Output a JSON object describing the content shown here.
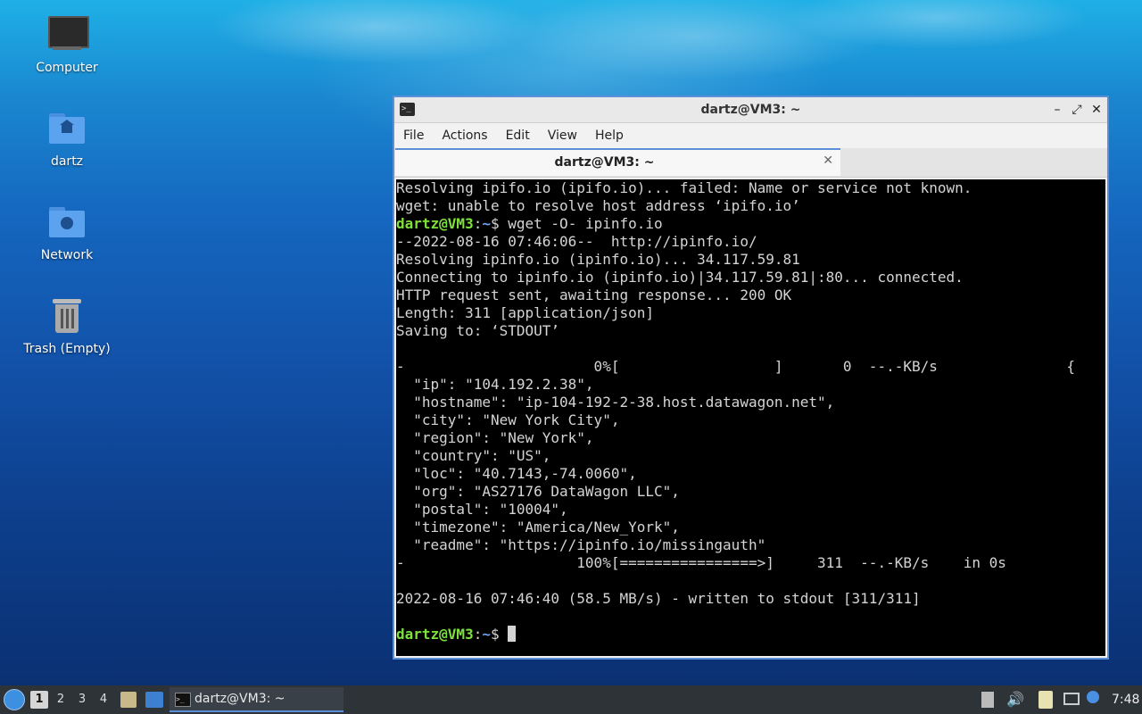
{
  "desktop": {
    "icons": [
      {
        "label": "Computer"
      },
      {
        "label": "dartz"
      },
      {
        "label": "Network"
      },
      {
        "label": "Trash (Empty)"
      }
    ]
  },
  "window": {
    "title": "dartz@VM3: ~",
    "controls": {
      "minimize": "–",
      "maximize": "⤢",
      "close": "✕"
    },
    "menu": [
      "File",
      "Actions",
      "Edit",
      "View",
      "Help"
    ],
    "tab": {
      "title": "dartz@VM3: ~",
      "close": "✕"
    }
  },
  "terminal": {
    "prompt_user": "dartz@VM3",
    "prompt_path": "~",
    "lines": [
      "Resolving ipifo.io (ipifo.io)... failed: Name or service not known.",
      "wget: unable to resolve host address ‘ipifo.io’",
      "",
      "--2022-08-16 07:46:06--  http://ipinfo.io/",
      "Resolving ipinfo.io (ipinfo.io)... 34.117.59.81",
      "Connecting to ipinfo.io (ipinfo.io)|34.117.59.81|:80... connected.",
      "HTTP request sent, awaiting response... 200 OK",
      "Length: 311 [application/json]",
      "Saving to: ‘STDOUT’",
      "",
      "-                      0%[                  ]       0  --.-KB/s               {",
      "  \"ip\": \"104.192.2.38\",",
      "  \"hostname\": \"ip-104-192-2-38.host.datawagon.net\",",
      "  \"city\": \"New York City\",",
      "  \"region\": \"New York\",",
      "  \"country\": \"US\",",
      "  \"loc\": \"40.7143,-74.0060\",",
      "  \"org\": \"AS27176 DataWagon LLC\",",
      "  \"postal\": \"10004\",",
      "  \"timezone\": \"America/New_York\",",
      "  \"readme\": \"https://ipinfo.io/missingauth\"",
      "-                    100%[================>]     311  --.-KB/s    in 0s",
      "",
      "2022-08-16 07:46:40 (58.5 MB/s) - written to stdout [311/311]",
      ""
    ],
    "command1": " wget -O- ipinfo.io",
    "dollar": "$"
  },
  "taskbar": {
    "workspaces": [
      "1",
      "2",
      "3",
      "4"
    ],
    "task_label": "dartz@VM3: ~",
    "clock": "7:48"
  },
  "colors": {
    "accent": "#5b8fd8",
    "prompt_user": "#7ee23a",
    "prompt_path": "#6fa0f0"
  }
}
